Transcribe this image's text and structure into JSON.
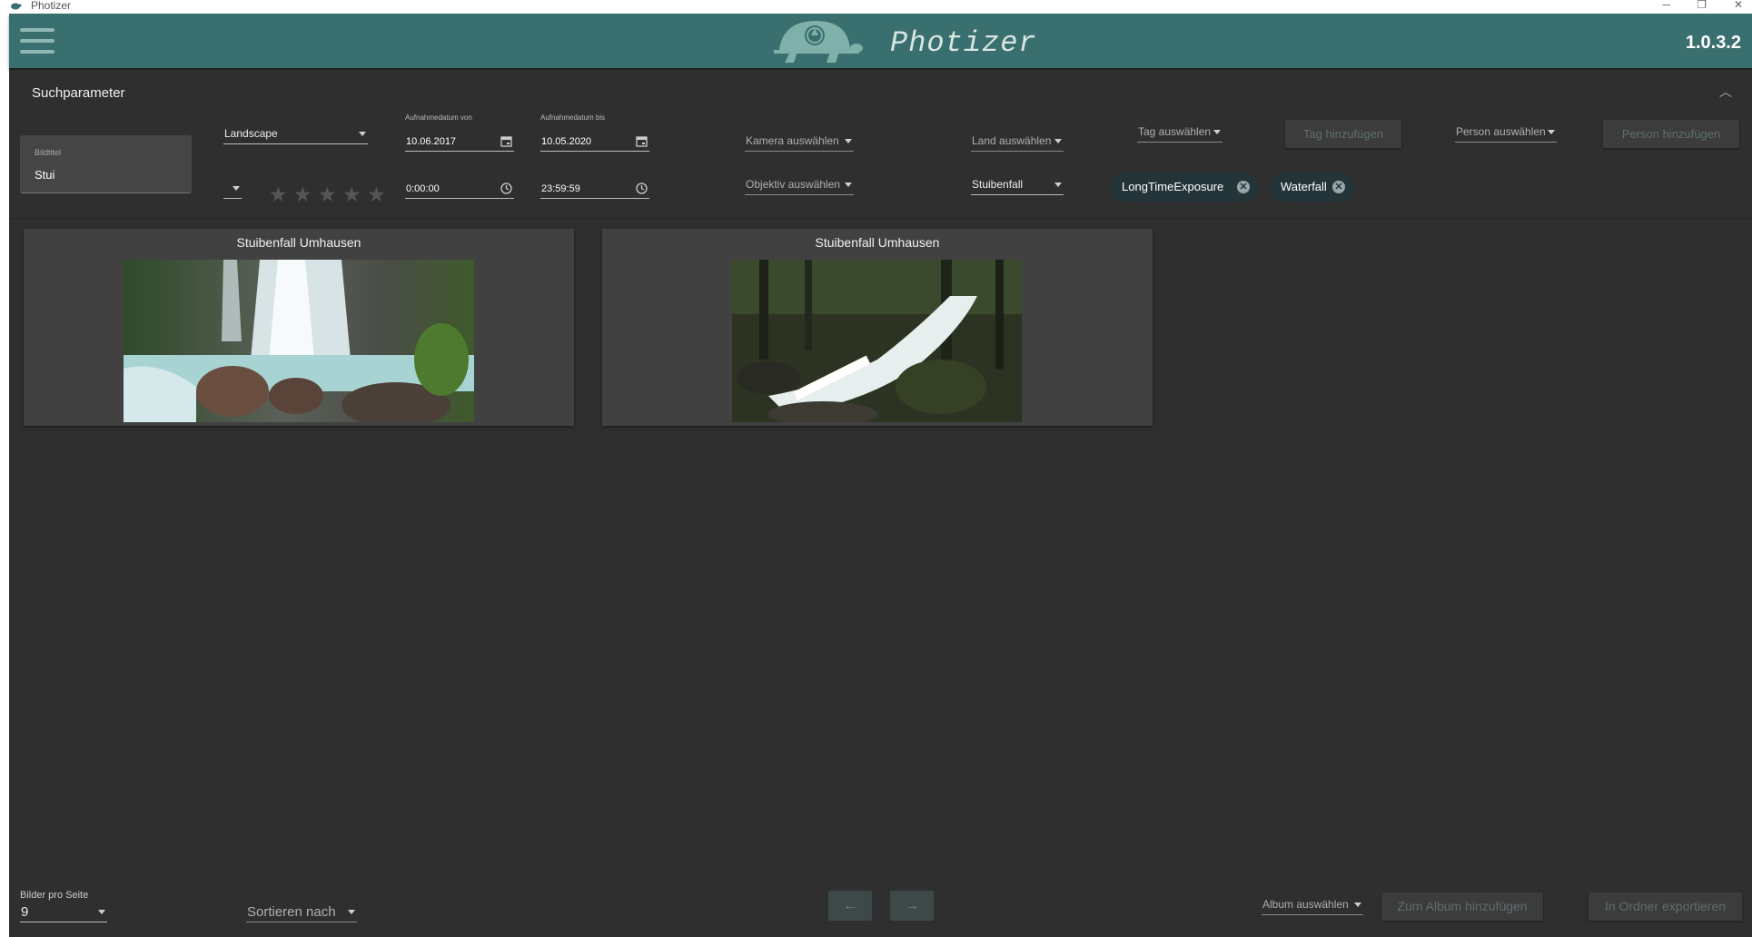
{
  "window": {
    "title": "Photizer",
    "minimize_glyph": "─",
    "maximize_glyph": "❐",
    "close_glyph": "✕"
  },
  "header": {
    "brand": "Photizer",
    "version": "1.0.3.2",
    "menu_icon": "hamburger-icon",
    "logo_icon": "turtle-aperture-logo"
  },
  "search": {
    "panel_title": "Suchparameter",
    "collapse_glyph": "︿",
    "title_field": {
      "label": "Bildtitel",
      "value": "Stui"
    },
    "category": {
      "value": "Landscape"
    },
    "rating_combo": {
      "value": ""
    },
    "stars": [
      "★",
      "★",
      "★",
      "★",
      "★"
    ],
    "date_from": {
      "label": "Aufnahmedatum von",
      "value": "10.06.2017"
    },
    "date_to": {
      "label": "Aufnahmedatum bis",
      "value": "10.05.2020"
    },
    "time_from": {
      "value": "0:00:00"
    },
    "time_to": {
      "value": "23:59:59"
    },
    "camera": {
      "placeholder": "Kamera auswählen"
    },
    "lens": {
      "placeholder": "Objektiv auswählen"
    },
    "country": {
      "placeholder": "Land auswählen"
    },
    "place": {
      "value": "Stuibenfall"
    },
    "tag": {
      "placeholder": "Tag auswählen",
      "add_label": "Tag hinzufügen"
    },
    "tags": [
      {
        "label": "LongTimeExposure",
        "remove_glyph": "✕"
      },
      {
        "label": "Waterfall",
        "remove_glyph": "✕"
      }
    ],
    "person": {
      "placeholder": "Person auswählen",
      "add_label": "Person hinzufügen"
    }
  },
  "results": [
    {
      "title": "Stuibenfall Umhausen",
      "image": "waterfall-over-rocks-photo"
    },
    {
      "title": "Stuibenfall Umhausen",
      "image": "forest-cascade-photo"
    }
  ],
  "footer": {
    "per_page_label": "Bilder pro Seite",
    "per_page_value": "9",
    "sort_placeholder": "Sortieren nach",
    "prev_glyph": "←",
    "next_glyph": "→",
    "album_placeholder": "Album auswählen",
    "add_album_label": "Zum Album hinzufügen",
    "export_label": "In Ordner exportieren"
  },
  "colors": {
    "header_bg": "#3a6f6f",
    "body_bg": "#2f2f2f",
    "card_bg": "#414141",
    "chip_bg": "#24353a"
  }
}
